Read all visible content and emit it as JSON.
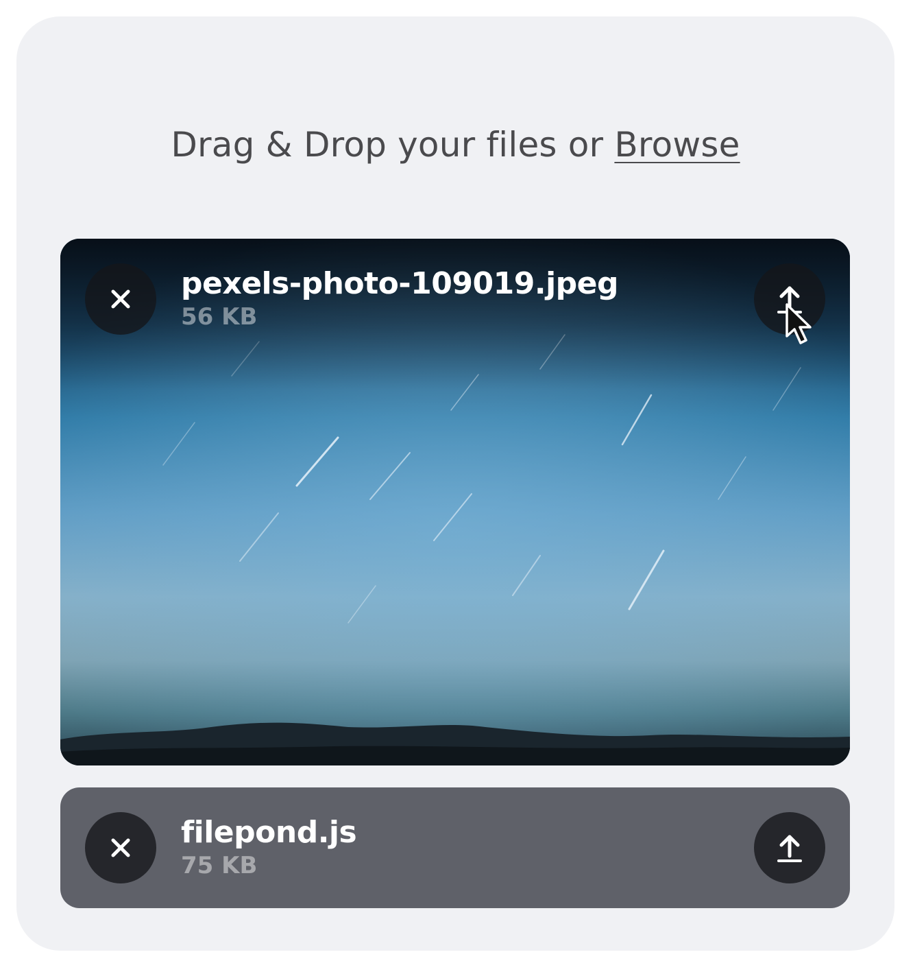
{
  "dropzone": {
    "label_prefix": "Drag & Drop your files or ",
    "browse_label": "Browse"
  },
  "files": [
    {
      "name": "pexels-photo-109019.jpeg",
      "size": "56 KB",
      "has_preview": true,
      "remove_icon": "close-icon",
      "upload_icon": "upload-icon"
    },
    {
      "name": "filepond.js",
      "size": "75 KB",
      "has_preview": false,
      "remove_icon": "close-icon",
      "upload_icon": "upload-icon"
    }
  ],
  "colors": {
    "panel_background": "#f0f1f4",
    "file_item_background": "#5f6169",
    "button_background": "#14161a",
    "label_text": "#4a4a4d"
  }
}
